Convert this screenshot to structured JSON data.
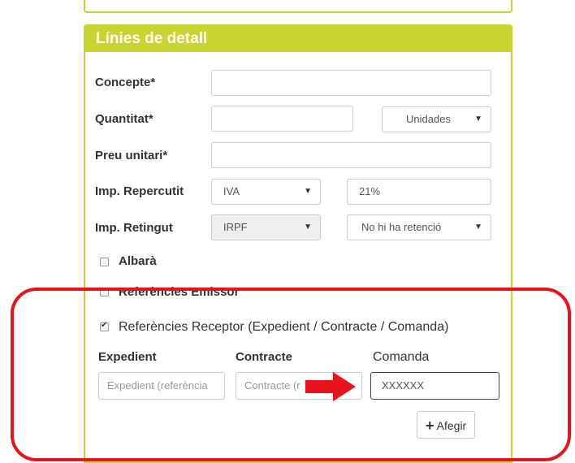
{
  "header": {
    "title": "Línies de detall"
  },
  "fields": {
    "concepte": {
      "label": "Concepte*",
      "value": ""
    },
    "quantitat": {
      "label": "Quantitat*",
      "value": "",
      "unit": "Unidades"
    },
    "preu": {
      "label": "Preu unitari*",
      "value": ""
    },
    "repercutit": {
      "label": "Imp. Repercutit",
      "type": "IVA",
      "rate": "21%"
    },
    "retingut": {
      "label": "Imp. Retingut",
      "type": "IRPF",
      "rate": "No hi ha retenció"
    }
  },
  "checks": {
    "albara": {
      "label": "Albarà",
      "checked": false
    },
    "emissor": {
      "label": "Referències Emissor",
      "checked": false
    },
    "receptor": {
      "label": "Referències Receptor (Expedient / Contracte / Comanda)",
      "checked": true
    }
  },
  "refs": {
    "expedient": {
      "label": "Expedient",
      "placeholder": "Expedient (referència"
    },
    "contracte": {
      "label": "Contracte",
      "placeholder": "Contracte (r"
    },
    "comanda": {
      "label": "Comanda",
      "value": "XXXXXX"
    }
  },
  "add_button": {
    "label": "Afegir",
    "icon": "plus-icon"
  },
  "colors": {
    "accent": "#c8d42f",
    "highlight": "#e8141c"
  }
}
